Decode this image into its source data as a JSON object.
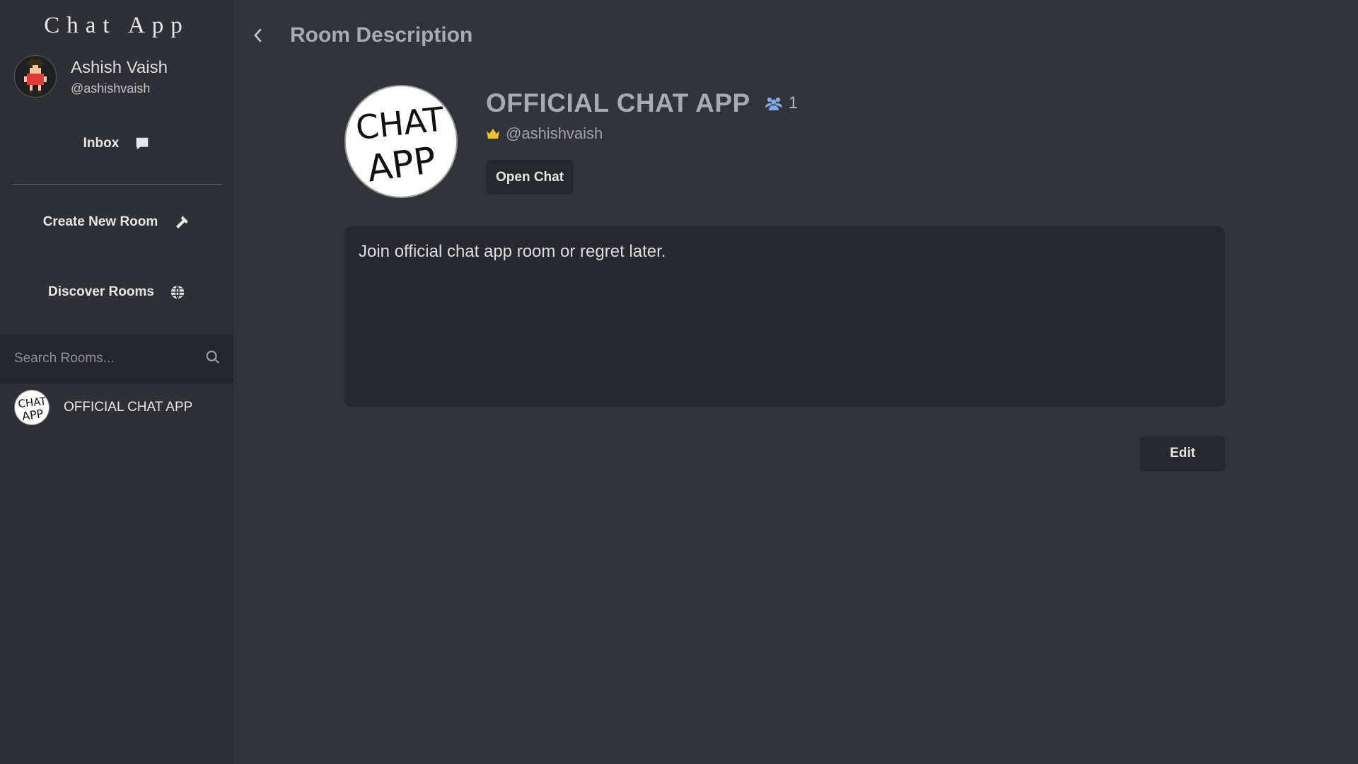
{
  "app": {
    "title": "Chat App"
  },
  "user": {
    "name": "Ashish Vaish",
    "handle": "@ashishvaish"
  },
  "nav": {
    "inbox": "Inbox",
    "create_room": "Create New Room",
    "discover_rooms": "Discover Rooms"
  },
  "search": {
    "placeholder": "Search Rooms..."
  },
  "rooms": [
    {
      "name": "OFFICIAL CHAT APP"
    }
  ],
  "page": {
    "title": "Room Description"
  },
  "room": {
    "name": "OFFICIAL CHAT APP",
    "member_count": "1",
    "owner_handle": "@ashishvaish",
    "open_chat_label": "Open Chat",
    "description": "Join official chat app room or regret later.",
    "edit_label": "Edit",
    "logo_text_top": "CHAT",
    "logo_text_bottom": "APP"
  },
  "colors": {
    "background": "#323339",
    "sidebar": "#2f3035",
    "panel": "#27282d",
    "member_icon": "#7fa8e8",
    "crown_icon": "#f2c12e"
  },
  "icons": [
    "chat-bubble-icon",
    "hammer-icon",
    "globe-icon",
    "search-icon",
    "back-chevron-icon",
    "users-icon",
    "crown-icon"
  ]
}
